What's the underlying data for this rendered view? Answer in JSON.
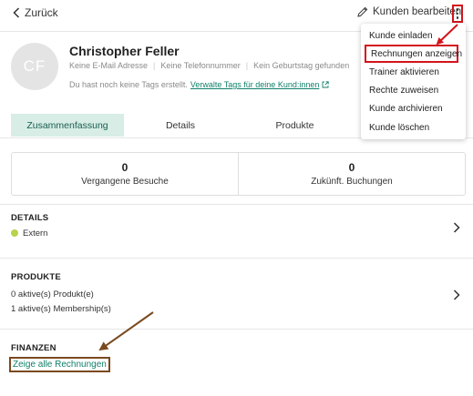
{
  "topbar": {
    "back_label": "Zurück",
    "edit_label": "Kunden bearbeiten"
  },
  "profile": {
    "initials": "CF",
    "name": "Christopher Feller",
    "meta": [
      "Keine E-Mail Adresse",
      "Keine Telefonnummer",
      "Kein Geburtstag gefunden"
    ],
    "tags_text": "Du hast noch keine Tags erstellt.",
    "tags_link": "Verwalte Tags für deine Kund:innen"
  },
  "tabs": [
    {
      "label": "Zusammenfassung",
      "active": true
    },
    {
      "label": "Details",
      "active": false
    },
    {
      "label": "Produkte",
      "active": false
    }
  ],
  "stats": [
    {
      "value": "0",
      "label": "Vergangene Besuche"
    },
    {
      "value": "0",
      "label": "Zukünft. Buchungen"
    }
  ],
  "sections": {
    "details": {
      "title": "DETAILS",
      "status": "Extern"
    },
    "produkte": {
      "title": "PRODUKTE",
      "lines": [
        "0 aktive(s) Produkt(e)",
        "1 aktive(s) Membership(s)"
      ]
    },
    "finanzen": {
      "title": "FINANZEN",
      "link": "Zeige alle Rechnungen"
    }
  },
  "menu": {
    "items": [
      "Kunde einladen",
      "Rechnungen anzeigen",
      "Trainer aktivieren",
      "Rechte zuweisen",
      "Kunde archivieren",
      "Kunde löschen"
    ]
  },
  "colors": {
    "accent": "#11806a",
    "active_tab_bg": "#d7ede6",
    "status_dot": "#b6d34a",
    "annotation_red": "#d3141b",
    "annotation_brown": "#7a4a1e"
  },
  "icons": [
    "chevron-left-icon",
    "pencil-icon",
    "kebab-menu-icon",
    "external-link-icon",
    "chevron-right-icon"
  ]
}
